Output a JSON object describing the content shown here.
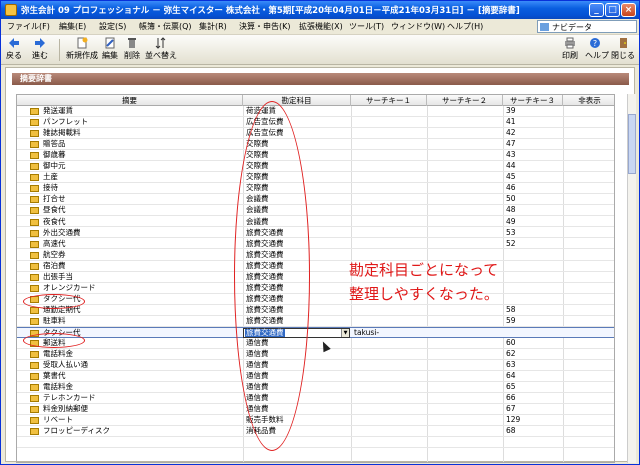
{
  "window": {
    "title": "弥生会計 09 プロフェッショナル － 弥生マイスター 株式会社・第5期[平成20年04月01日－平成21年03月31日] － [摘要辞書]"
  },
  "menu": [
    {
      "label": "ファイル(F)"
    },
    {
      "label": "編集(E)"
    },
    {
      "label": "設定(S)"
    },
    {
      "label": "帳簿・伝票(Q)"
    },
    {
      "label": "集計(R)"
    },
    {
      "label": "決算・申告(K)"
    },
    {
      "label": "拡張機能(X)"
    },
    {
      "label": "ツール(T)"
    },
    {
      "label": "ウィンドウ(W)"
    },
    {
      "label": "ヘルプ(H)"
    }
  ],
  "navi_label": "ナビデータ",
  "toolbar": {
    "back": "戻る",
    "forward": "進む",
    "new": "新規作成",
    "edit": "編集",
    "delete": "削除",
    "sort": "並べ替え",
    "print": "印刷",
    "help": "ヘルプ",
    "close": "閉じる"
  },
  "section_title": "摘要辞書",
  "columns": {
    "summary": "摘要",
    "account": "勘定科目",
    "key1": "サーチキー１",
    "key2": "サーチキー２",
    "key3": "サーチキー３",
    "hidden": "非表示"
  },
  "rows": [
    {
      "name": "発送運賃",
      "account": "荷造運賃",
      "key1": "",
      "key3": "39"
    },
    {
      "name": "パンフレット",
      "account": "広告宣伝費",
      "key1": "",
      "key3": "41"
    },
    {
      "name": "雑誌掲載料",
      "account": "広告宣伝費",
      "key1": "",
      "key3": "42"
    },
    {
      "name": "贈答品",
      "account": "交際費",
      "key1": "",
      "key3": "47"
    },
    {
      "name": "御歳暮",
      "account": "交際費",
      "key1": "",
      "key3": "43"
    },
    {
      "name": "御中元",
      "account": "交際費",
      "key1": "",
      "key3": "44"
    },
    {
      "name": "土産",
      "account": "交際費",
      "key1": "",
      "key3": "45"
    },
    {
      "name": "接待",
      "account": "交際費",
      "key1": "",
      "key3": "46"
    },
    {
      "name": "打合せ",
      "account": "会議費",
      "key1": "",
      "key3": "50"
    },
    {
      "name": "昼食代",
      "account": "会議費",
      "key1": "",
      "key3": "48"
    },
    {
      "name": "夜食代",
      "account": "会議費",
      "key1": "",
      "key3": "49"
    },
    {
      "name": "外出交通費",
      "account": "旅費交通費",
      "key1": "",
      "key3": "53"
    },
    {
      "name": "高速代",
      "account": "旅費交通費",
      "key1": "",
      "key3": "52"
    },
    {
      "name": "航空券",
      "account": "旅費交通費",
      "key1": "",
      "key3": ""
    },
    {
      "name": "宿泊費",
      "account": "旅費交通費",
      "key1": "",
      "key3": ""
    },
    {
      "name": "出張手当",
      "account": "旅費交通費",
      "key1": "",
      "key3": ""
    },
    {
      "name": "オレンジカード",
      "account": "旅費交通費",
      "key1": "",
      "key3": ""
    },
    {
      "name": "タクシー代",
      "account": "旅費交通費",
      "key1": "",
      "key3": ""
    },
    {
      "name": "通勤定期代",
      "account": "旅費交通費",
      "key1": "",
      "key3": "58"
    },
    {
      "name": "駐車料",
      "account": "旅費交通費",
      "key1": "",
      "key3": "59"
    },
    {
      "name": "タクシー代",
      "account": "旅費交通費",
      "key1": "takusi-",
      "key3": "",
      "selected": true
    },
    {
      "name": "郵送料",
      "account": "通信費",
      "key1": "",
      "key3": "60"
    },
    {
      "name": "電話料金",
      "account": "通信費",
      "key1": "",
      "key3": "62"
    },
    {
      "name": "受取人払い通",
      "account": "通信費",
      "key1": "",
      "key3": "63"
    },
    {
      "name": "葉書代",
      "account": "通信費",
      "key1": "",
      "key3": "64"
    },
    {
      "name": "電話料金",
      "account": "通信費",
      "key1": "",
      "key3": "65"
    },
    {
      "name": "テレホンカード",
      "account": "通信費",
      "key1": "",
      "key3": "66"
    },
    {
      "name": "料金別納郵便",
      "account": "通信費",
      "key1": "",
      "key3": "67"
    },
    {
      "name": "リベート",
      "account": "販売手数料",
      "key1": "",
      "key3": "129"
    },
    {
      "name": "フロッピーディスク",
      "account": "消耗品費",
      "key1": "",
      "key3": "68"
    },
    {
      "name": "",
      "account": "",
      "key1": "",
      "key3": ""
    }
  ],
  "annotation": {
    "line1": "勘定科目ごとになって",
    "line2": "整理しやすくなった。"
  },
  "colors": {
    "title": "#0a5fe0",
    "highlight": "#e02020",
    "section": "#8a5a4a"
  }
}
